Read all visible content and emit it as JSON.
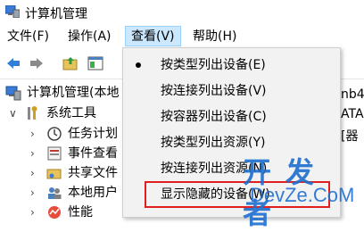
{
  "window": {
    "title": "计算机管理"
  },
  "menubar": {
    "items": [
      {
        "label": "文件(F)"
      },
      {
        "label": "操作(A)"
      },
      {
        "label": "查看(V)"
      },
      {
        "label": "帮助(H)"
      }
    ]
  },
  "tree": {
    "root": "计算机管理(本地",
    "system_tools": "系统工具",
    "children": [
      {
        "label": "任务计划"
      },
      {
        "label": "事件查看"
      },
      {
        "label": "共享文件"
      },
      {
        "label": "本地用户"
      },
      {
        "label": "性能"
      }
    ]
  },
  "right_pane": {
    "frag1": "nb4",
    "frag2": "ATA",
    "frag3": "[器"
  },
  "view_menu": {
    "items": [
      {
        "label": "按类型列出设备(E)",
        "checked": true
      },
      {
        "label": "按连接列出设备(V)",
        "checked": false
      },
      {
        "label": "按容器列出设备(C)",
        "checked": false
      },
      {
        "label": "按类型列出资源(Y)",
        "checked": false
      },
      {
        "label": "按连接列出资源(N)",
        "checked": false
      },
      {
        "label": "显示隐藏的设备(W)",
        "checked": false
      }
    ]
  },
  "watermark": {
    "top": "开发者",
    "bottom": "DevZe.CoM"
  },
  "colors": {
    "menu_active": "#cce8ff",
    "highlight": "#e02020",
    "watermark": "#1e6fd0"
  }
}
